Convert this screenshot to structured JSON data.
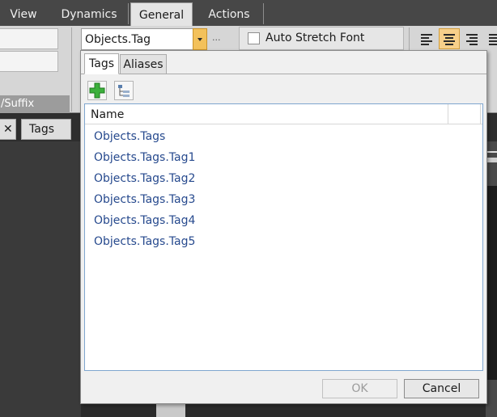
{
  "ribbon": {
    "tabs": [
      {
        "label": "View"
      },
      {
        "label": "Dynamics"
      },
      {
        "label": "General"
      },
      {
        "label": "Actions"
      }
    ],
    "group_label": "/Suffix",
    "tag_combo": {
      "value": "Objects.Tag",
      "more_label": "..."
    },
    "auto_stretch_font": {
      "label": "Auto Stretch Font",
      "checked": false
    },
    "align_center_active": true
  },
  "doc_tabs": [
    {
      "label": "Tags"
    }
  ],
  "popup": {
    "tabs": [
      {
        "label": "Tags"
      },
      {
        "label": "Aliases"
      }
    ],
    "grid": {
      "column_header": "Name",
      "items": [
        "Objects.Tags",
        "Objects.Tags.Tag1",
        "Objects.Tags.Tag2",
        "Objects.Tags.Tag3",
        "Objects.Tags.Tag4",
        "Objects.Tags.Tag5"
      ]
    },
    "ok_label": "OK",
    "cancel_label": "Cancel"
  },
  "colors": {
    "accent": "#f3c15b",
    "link": "#274a8e",
    "add_icon": "#3cb03c"
  },
  "icons": [
    "add-tag-icon",
    "tag-tree-icon",
    "close-icon",
    "dropdown-arrow-icon"
  ]
}
